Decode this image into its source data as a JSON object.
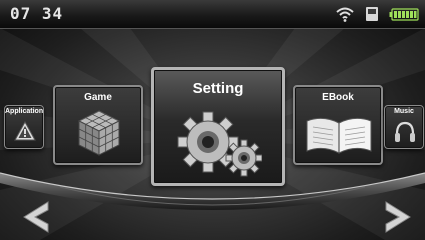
{
  "status": {
    "time": "07 34",
    "wifi_icon": "wifi-icon",
    "storage_icon": "sd-card-icon",
    "battery_icon": "battery-icon"
  },
  "menu": {
    "items": [
      {
        "label": "Application",
        "icon": "warning-triangle-icon"
      },
      {
        "label": "Game",
        "icon": "rubiks-cube-icon"
      },
      {
        "label": "Setting",
        "icon": "gears-icon",
        "selected": true
      },
      {
        "label": "EBook",
        "icon": "open-book-icon"
      },
      {
        "label": "Music",
        "icon": "headphones-icon"
      }
    ]
  },
  "nav": {
    "prev_icon": "chevron-left-icon",
    "next_icon": "chevron-right-icon"
  },
  "colors": {
    "background": "#2e2e2e",
    "status_bar": "#1a1a1a",
    "battery": "#9fe05a",
    "tile_border": "#b5b5b5"
  }
}
